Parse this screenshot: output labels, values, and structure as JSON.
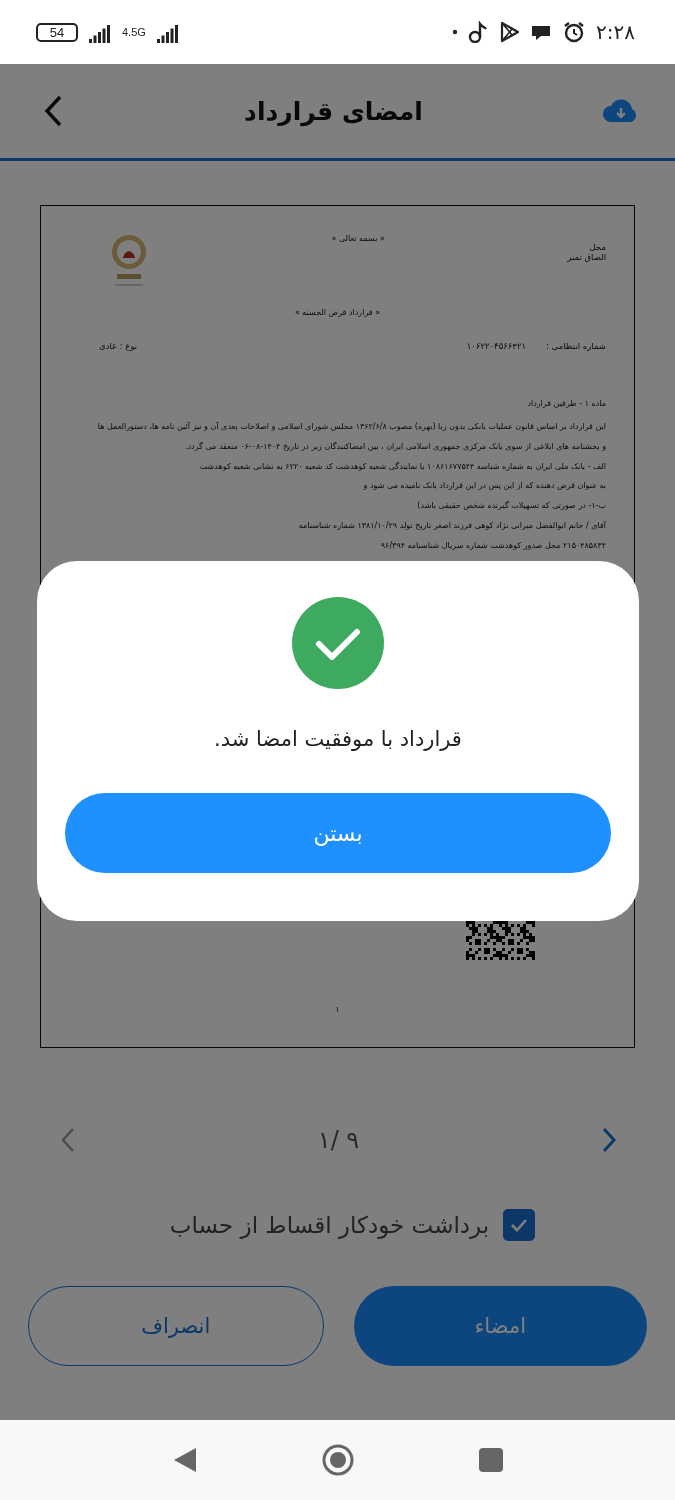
{
  "status_bar": {
    "time": "۲:۲۸",
    "battery": "54",
    "network": "4.5G"
  },
  "header": {
    "title": "امضای قرارداد"
  },
  "document": {
    "greeting": "« بسمه تعالی »",
    "stamp_place": [
      "محل",
      "الصاق تمبر"
    ],
    "title": "« قرارداد قرض الحسنه »",
    "number_label": "شماره انتظامی :",
    "number": "۱۰۶۲۲۰۴۵۶۶۳۲۱",
    "type": "نوع : عادی",
    "article": "ماده ۱ - طرفین قرارداد",
    "paragraphs": [
      "این قرارداد بر اساس قانون عملیات بانکی بدون ربا (بهره) مصوب ۱۳۶۲/۶/۸ مجلس شورای اسلامی و اصلاحات بعدی آن و نیز آئین نامه ها، دستورالعمل ها",
      "و بخشنامه های ابلاغی از سوی بانک مرکزی جمهوری اسلامی ایران ، بین امضاکنندگان زیر در تاریخ ۱۴۰۴-۰۸-۰۶ منعقد می گردد.",
      "الف - بانک ملی ایران به شماره شناسه ۱۰۸۶۱۶۷۷۵۴۴ با نمایندگی شعبه کوهدشت کد شعبه ۶۲۲۰ به نشانی شعبه کوهدشت",
      "به عنوان قرض دهنده که از این پس در این قرارداد بانک نامیده می شود و",
      "ب-۱- در صورتی که تسهیلات گیرنده شخص حقیقی باشد)",
      "آقای / خانم ابوالفضل میرانی نژاد کوهی فرزند اصغر تاریخ تولد ۱۳۸۱/۱۰/۲۹ شماره شناسنامه",
      "۲۱۵۰۴۸۵۸۳۴ محل صدور کوهدشت شماره سریال شناسنامه ۹۶/۳۹۴"
    ],
    "page_number": "۱"
  },
  "pager": {
    "current": "۱/ ۹"
  },
  "auto_debit": {
    "label": "برداشت خودکار اقساط از حساب",
    "checked": true
  },
  "buttons": [
    {
      "label": "امضاء",
      "kind": "primary"
    },
    {
      "label": "انصراف",
      "kind": "outline"
    }
  ],
  "dialog": {
    "message": "قرارداد با موفقیت امضا شد.",
    "button": "بستن"
  }
}
